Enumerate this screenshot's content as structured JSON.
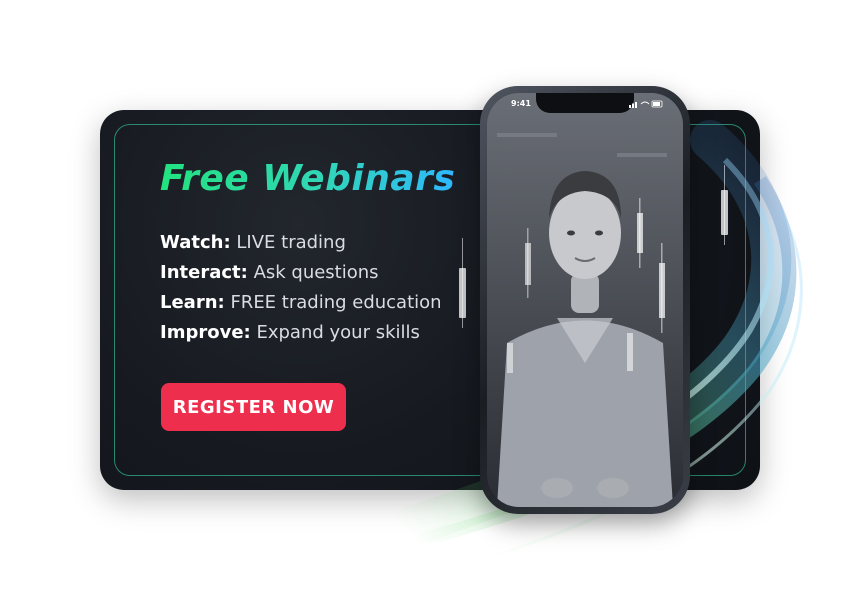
{
  "title": "Free Webinars",
  "features": [
    {
      "key": "Watch:",
      "text": "LIVE trading"
    },
    {
      "key": "Interact:",
      "text": "Ask questions"
    },
    {
      "key": "Learn:",
      "text": "FREE trading education"
    },
    {
      "key": "Improve:",
      "text": "Expand your skills"
    }
  ],
  "cta": {
    "label": "REGISTER NOW"
  },
  "phone": {
    "time": "9:41"
  },
  "colors": {
    "card_bg": "#161a20",
    "title_gradient_start": "#22e37f",
    "title_gradient_end": "#2eb8ff",
    "cta_bg": "#ee2e4d",
    "border_accent": "#38e6b4"
  }
}
